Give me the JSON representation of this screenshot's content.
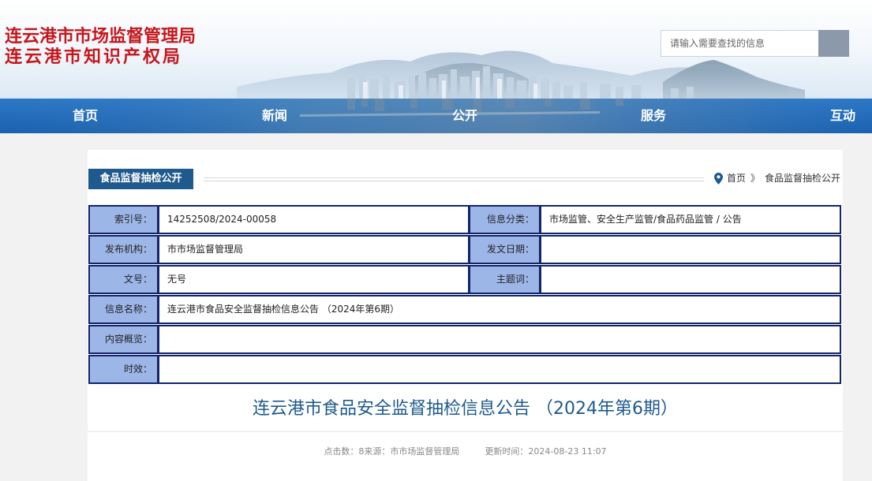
{
  "header": {
    "title_line1": "连云港市市场监督管理局",
    "title_line2": "连云港市知识产权局",
    "title_color": "#c5171c"
  },
  "search": {
    "placeholder": "请输入需要查找的信息",
    "button_icon": "search-icon"
  },
  "nav": {
    "items": [
      {
        "label": "首页"
      },
      {
        "label": "新闻"
      },
      {
        "label": "公开"
      },
      {
        "label": "服务"
      },
      {
        "label": "互动"
      }
    ],
    "color": "#1f66b3"
  },
  "section": {
    "tab_label": "食品监督抽检公开",
    "tab_color": "#1e5a8d"
  },
  "breadcrumb": {
    "icon": "location-pin-icon",
    "home": "首页",
    "separator": "》",
    "current": "食品监督抽检公开"
  },
  "info": {
    "index_label": "索引号：",
    "index_value": "14252508/2024-00058",
    "category_label": "信息分类：",
    "category_value": "市场监管、安全生产监管/食品药品监管 / 公告",
    "publisher_label": "发布机构：",
    "publisher_value": "市市场监督管理局",
    "date_label": "发文日期：",
    "date_value": "",
    "docno_label": "文号：",
    "docno_value": "无号",
    "keyword_label": "主题词：",
    "keyword_value": "",
    "name_label": "信息名称：",
    "name_value": "连云港市食品安全监督抽检信息公告 （2024年第6期）",
    "summary_label": "内容概览：",
    "summary_value": "",
    "validity_label": "时效：",
    "validity_value": "",
    "label_bg": "#9db6e8",
    "border_color": "#12256b"
  },
  "article": {
    "title": "连云港市食品安全监督抽检信息公告 （2024年第6期）",
    "meta_clicks": "点击数：8来源：市市场监督管理局",
    "meta_updated": "更新时间：2024-08-23 11:07"
  }
}
